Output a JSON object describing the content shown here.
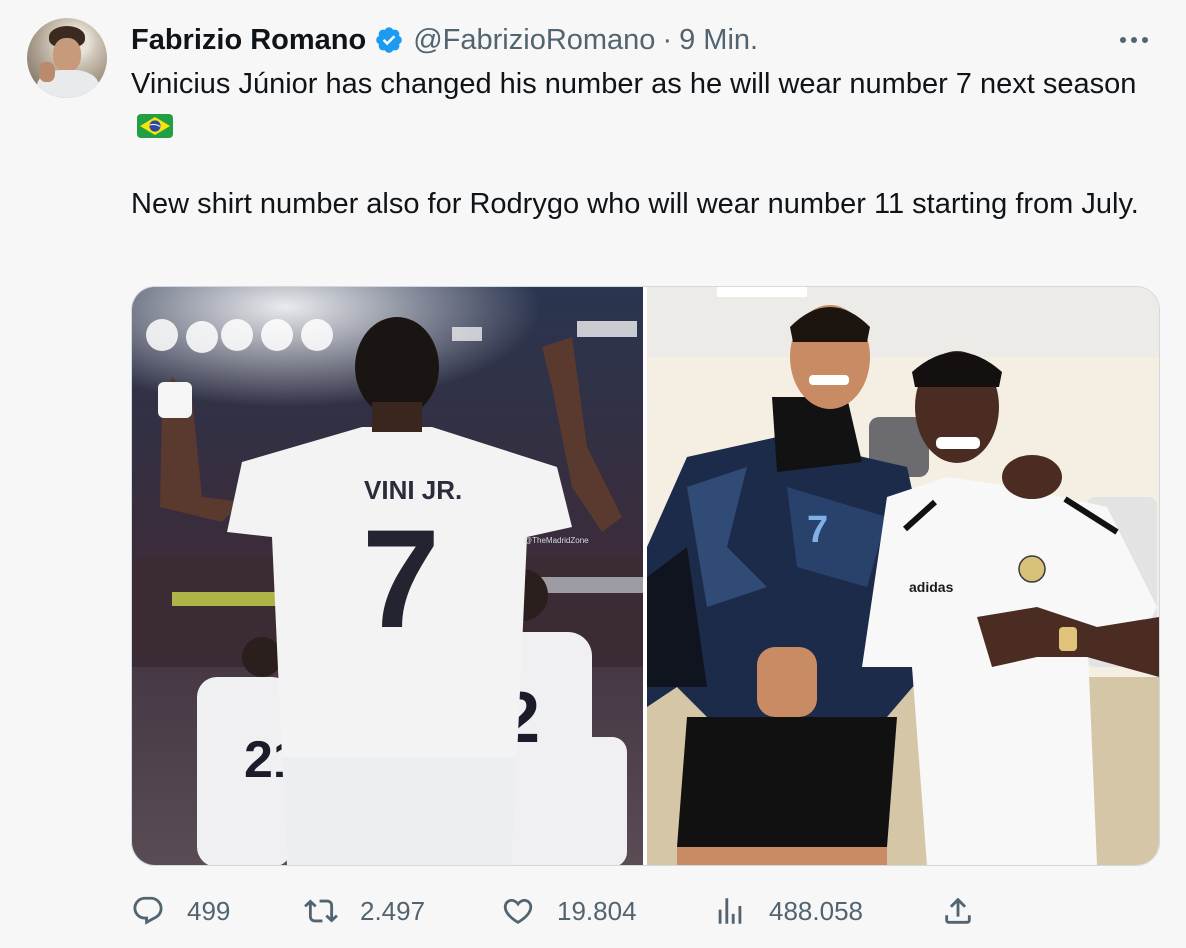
{
  "author": {
    "name": "Fabrizio Romano",
    "handle": "@FabrizioRomano",
    "separator": "·",
    "time": "9 Min.",
    "verified": true
  },
  "tweet": {
    "paragraph_1": "Vinicius Júnior has changed his number as he will wear number 7 next season",
    "flag_icon": "brazil-flag-emoji",
    "paragraph_2": "New shirt number also for Rodrygo who will wear number 11 starting from July."
  },
  "media": {
    "left_photo": {
      "jersey_name": "VINI JR.",
      "jersey_number": "7",
      "watermark": "@TheMadridZone",
      "teammate_number_1": "21",
      "teammate_number_2": "2"
    },
    "right_photo": {
      "jersey_number": "7",
      "shirt_brand": "adidas"
    }
  },
  "actions": {
    "replies": "499",
    "reposts": "2.497",
    "likes": "19.804",
    "views": "488.058"
  },
  "colors": {
    "background": "#f7f7f7",
    "text": "#0f1419",
    "muted": "#536471",
    "verified": "#1d9bf0",
    "border": "#cfd9de"
  }
}
